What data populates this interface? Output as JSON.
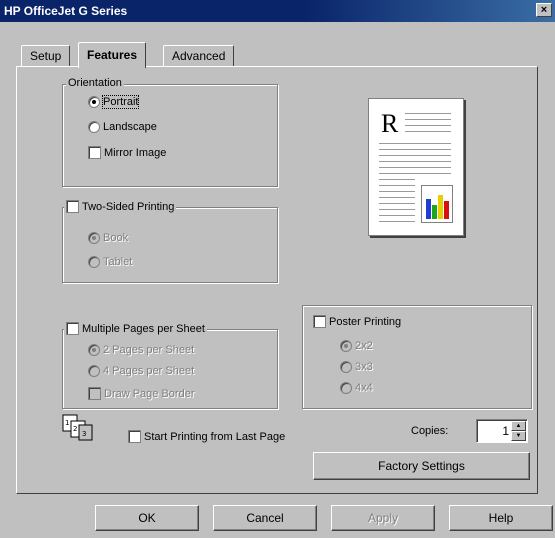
{
  "window": {
    "title": "HP OfficeJet G Series",
    "close_label": "×"
  },
  "tabs": [
    {
      "label": "Setup"
    },
    {
      "label": "Features"
    },
    {
      "label": "Advanced"
    }
  ],
  "orientation": {
    "legend": "Orientation",
    "portrait": "Portrait",
    "landscape": "Landscape",
    "mirror": "Mirror Image",
    "selected": "Portrait"
  },
  "two_sided": {
    "label": "Two-Sided Printing",
    "option1": "Book",
    "option2": "Tablet"
  },
  "multiple_pages": {
    "label": "Multiple Pages per Sheet",
    "option1": "2 Pages per Sheet",
    "option2": "4 Pages per Sheet",
    "option3": "Draw Page Border"
  },
  "poster": {
    "label": "Poster Printing",
    "option1": "2x2",
    "option2": "3x3",
    "option3": "4x4"
  },
  "start_last": {
    "label": "Start Printing from Last Page"
  },
  "copies": {
    "label": "Copies:",
    "value": "1"
  },
  "factory_button": "Factory Settings",
  "preview": {
    "letter": "R"
  },
  "bottom_buttons": {
    "ok": "OK",
    "cancel": "Cancel",
    "apply": "Apply",
    "help": "Help"
  },
  "icons": {
    "preview_chart": "bar-chart-icon",
    "page_order": "page-order-icon"
  },
  "colors": {
    "titlebar": "#0a246a",
    "face": "#c0c0c0",
    "chart_blue": "#1f3fd0",
    "chart_green": "#1aa81a",
    "chart_yellow": "#e8d000",
    "chart_red": "#d81010"
  }
}
